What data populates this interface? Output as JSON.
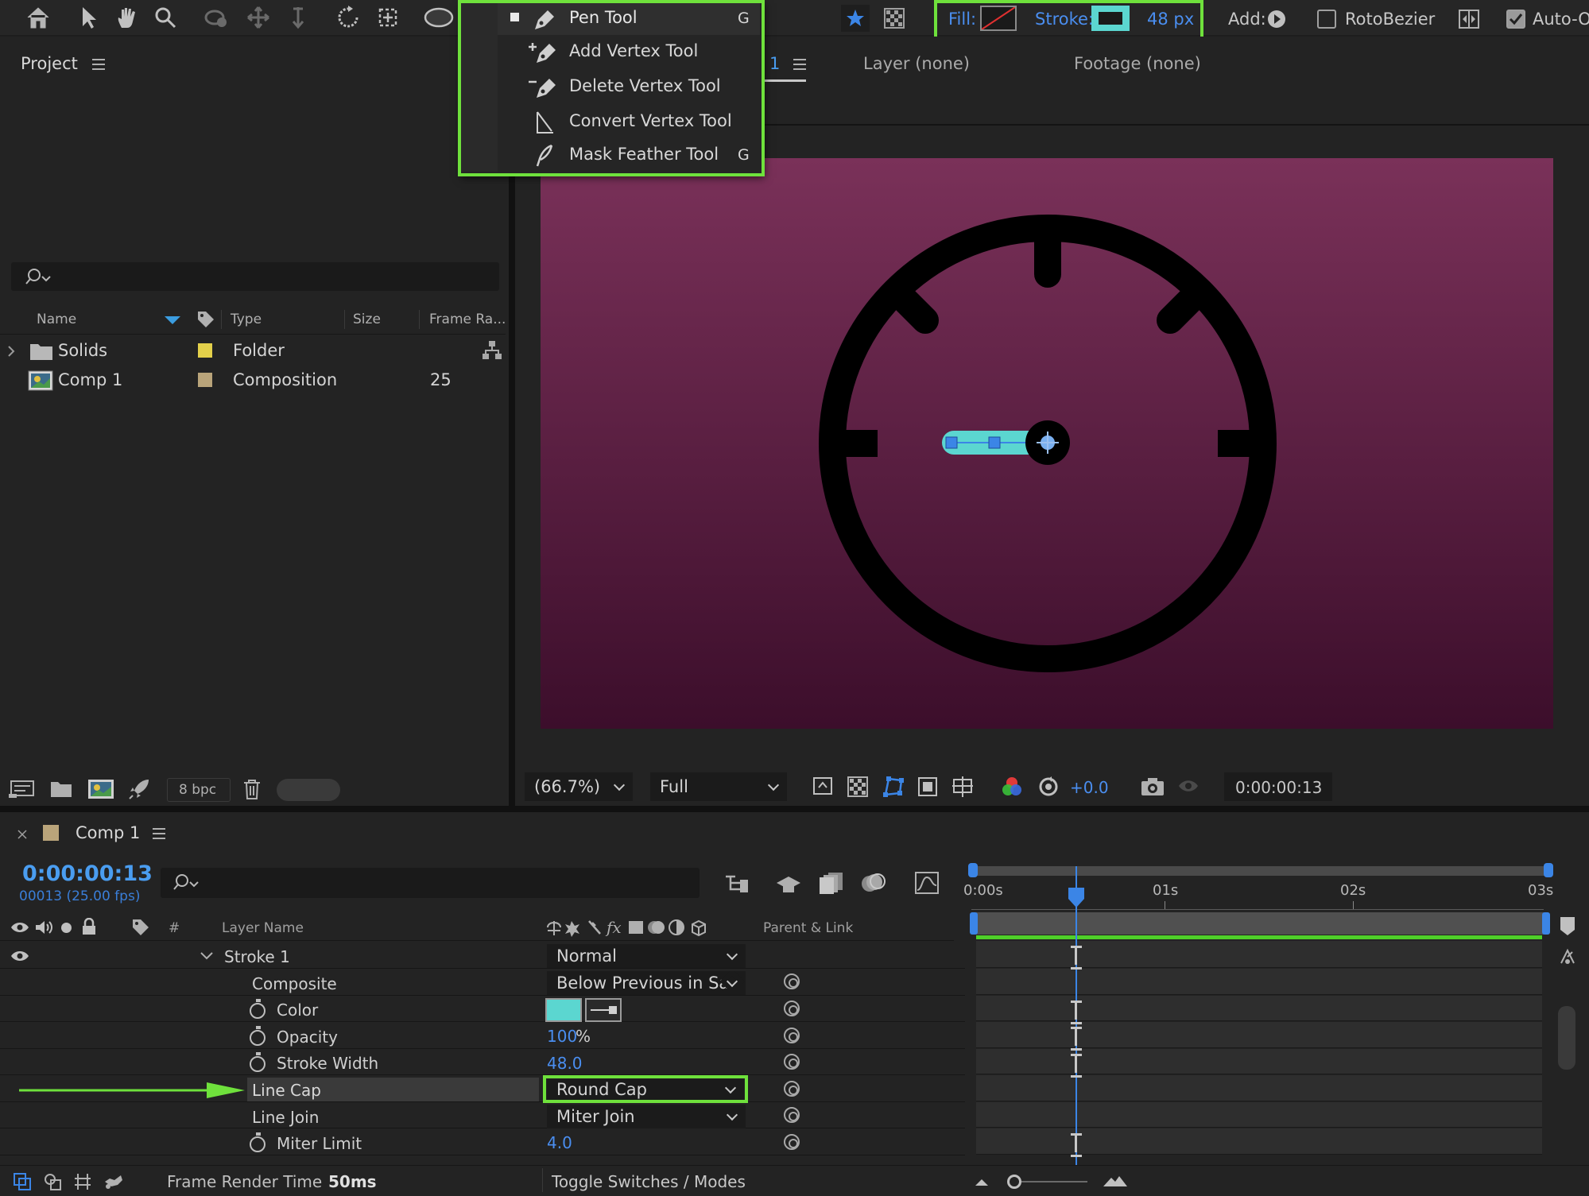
{
  "toolbar": {
    "fill_label": "Fill:",
    "stroke_label": "Stroke:",
    "stroke_width": "48 px",
    "add_label": "Add:",
    "rotobezier_label": "RotoBezier",
    "auto_label": "Auto-O"
  },
  "pen_menu": {
    "items": [
      {
        "label": "Pen Tool",
        "shortcut": "G"
      },
      {
        "label": "Add Vertex Tool",
        "shortcut": ""
      },
      {
        "label": "Delete Vertex Tool",
        "shortcut": ""
      },
      {
        "label": "Convert Vertex Tool",
        "shortcut": ""
      },
      {
        "label": "Mask Feather Tool",
        "shortcut": "G"
      }
    ]
  },
  "project": {
    "title": "Project",
    "columns": [
      "Name",
      "Type",
      "Size",
      "Frame Ra..."
    ],
    "rows": [
      {
        "name": "Solids",
        "type": "Folder",
        "frame_rate": ""
      },
      {
        "name": "Comp 1",
        "type": "Composition",
        "frame_rate": "25"
      }
    ],
    "bpc": "8 bpc"
  },
  "viewer": {
    "tab_num": "1",
    "layer_tab": "Layer (none)",
    "footage_tab": "Footage (none)",
    "zoom": "(66.7%)",
    "resolution": "Full",
    "exposure": "+0.0",
    "timecode": "0:00:00:13"
  },
  "timeline": {
    "comp_tab": "Comp 1",
    "current_time": "0:00:00:13",
    "frame_info": "00013 (25.00 fps)",
    "col_hash": "#",
    "col_layer_name": "Layer Name",
    "col_parent": "Parent & Link",
    "ruler": [
      "0:00s",
      "01s",
      "02s",
      "03s"
    ],
    "properties": {
      "stroke": {
        "name": "Stroke 1",
        "value": "Normal"
      },
      "composite": {
        "name": "Composite",
        "value": "Below Previous in Sa"
      },
      "color": {
        "name": "Color"
      },
      "opacity": {
        "name": "Opacity",
        "value": "100",
        "unit": "%"
      },
      "stroke_width": {
        "name": "Stroke Width",
        "value": "48.0"
      },
      "line_cap": {
        "name": "Line Cap",
        "value": "Round Cap"
      },
      "line_join": {
        "name": "Line Join",
        "value": "Miter Join"
      },
      "miter_limit": {
        "name": "Miter Limit",
        "value": "4.0"
      }
    },
    "status_frame_render_label": "Frame Render Time",
    "status_frame_render_value": "50ms",
    "toggle_label": "Toggle Switches / Modes"
  },
  "colors": {
    "accent_green": "#6fe13c",
    "stroke_teal": "#5bd6d0",
    "timecode_blue": "#4a8ef0",
    "canvas_top": "#7a3159",
    "canvas_bottom": "#3c0e2b"
  }
}
